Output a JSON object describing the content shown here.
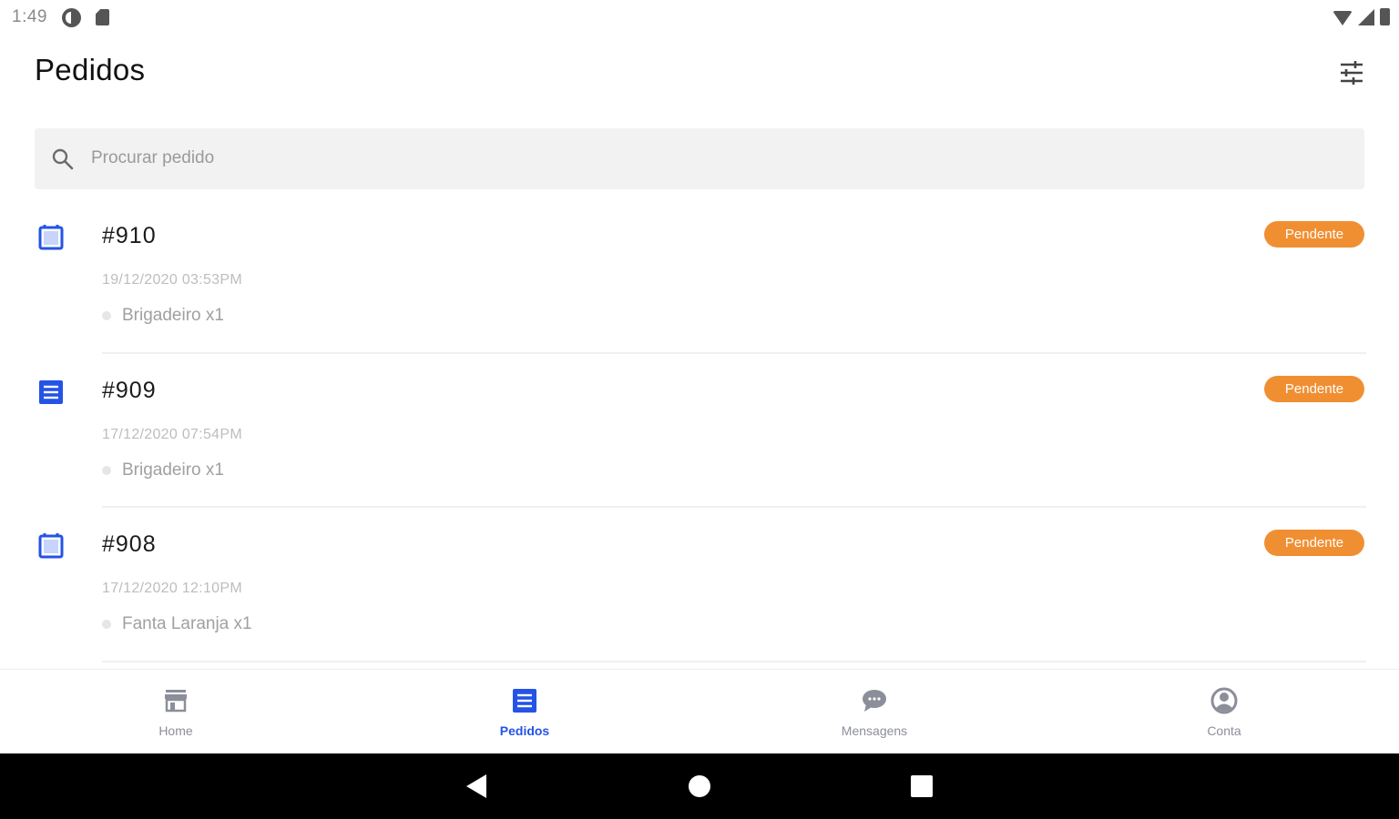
{
  "status_bar": {
    "time": "1:49"
  },
  "header": {
    "title": "Pedidos",
    "filter_icon": "tune-icon"
  },
  "search": {
    "placeholder": "Procurar pedido",
    "value": ""
  },
  "orders": [
    {
      "number": "#910",
      "date": "19/12/2020  03:53PM",
      "item": "Brigadeiro x1",
      "status": "Pendente",
      "icon": "order-icon"
    },
    {
      "number": "#909",
      "date": "17/12/2020  07:54PM",
      "item": "Brigadeiro x1",
      "status": "Pendente",
      "icon": "receipt-list-icon"
    },
    {
      "number": "#908",
      "date": "17/12/2020  12:10PM",
      "item": "Fanta Laranja x1",
      "status": "Pendente",
      "icon": "order-icon"
    }
  ],
  "bottom_nav": [
    {
      "label": "Home",
      "icon": "store-icon",
      "active": false
    },
    {
      "label": "Pedidos",
      "icon": "list-icon",
      "active": true
    },
    {
      "label": "Mensagens",
      "icon": "chat-icon",
      "active": false
    },
    {
      "label": "Conta",
      "icon": "account-icon",
      "active": false
    }
  ],
  "colors": {
    "accent": "#2453e6",
    "badge": "#f08f32",
    "nav_inactive": "#8c8f9a",
    "search_bg": "#f2f2f2"
  }
}
